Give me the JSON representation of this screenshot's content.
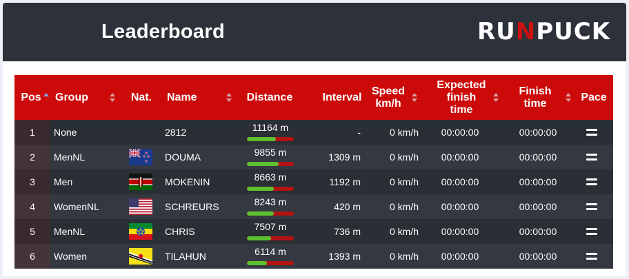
{
  "header": {
    "title": "Leaderboard",
    "logo": {
      "part1": "RU",
      "part2": "N",
      "part3": "PUCK",
      "accent_color": "#cc1111"
    }
  },
  "table": {
    "columns": {
      "pos": "Pos",
      "group": "Group",
      "nat": "Nat.",
      "name": "Name",
      "distance": "Distance",
      "interval": "Interval",
      "speed_line1": "Speed",
      "speed_line2": "km/h",
      "expected_line1": "Expected",
      "expected_line2": "finish",
      "expected_line3": "time",
      "finish_line1": "Finish",
      "finish_line2": "time",
      "pace": "Pace"
    },
    "header_color": "#cc0a0a",
    "rows": [
      {
        "pos": "1",
        "group": "None",
        "flag": "",
        "name": "2812",
        "distance": "11164 m",
        "progress": 0.62,
        "interval": "-",
        "speed": "0 km/h",
        "expected": "00:00:00",
        "finish": "00:00:00"
      },
      {
        "pos": "2",
        "group": "MenNL",
        "flag": "new-zealand-flag",
        "name": "DOUMA",
        "distance": "9855 m",
        "progress": 0.67,
        "interval": "1309 m",
        "speed": "0 km/h",
        "expected": "00:00:00",
        "finish": "00:00:00"
      },
      {
        "pos": "3",
        "group": "Men",
        "flag": "kenya-flag",
        "name": "MOKENIN",
        "distance": "8663 m",
        "progress": 0.58,
        "interval": "1192 m",
        "speed": "0 km/h",
        "expected": "00:00:00",
        "finish": "00:00:00"
      },
      {
        "pos": "4",
        "group": "WomenNL",
        "flag": "usa-flag",
        "name": "SCHREURS",
        "distance": "8243 m",
        "progress": 0.57,
        "interval": "420 m",
        "speed": "0 km/h",
        "expected": "00:00:00",
        "finish": "00:00:00"
      },
      {
        "pos": "5",
        "group": "MenNL",
        "flag": "ethiopia-flag",
        "name": "CHRIS",
        "distance": "7507 m",
        "progress": 0.52,
        "interval": "736 m",
        "speed": "0 km/h",
        "expected": "00:00:00",
        "finish": "00:00:00"
      },
      {
        "pos": "6",
        "group": "Women",
        "flag": "brunei-flag",
        "name": "TILAHUN",
        "distance": "6114 m",
        "progress": 0.43,
        "interval": "1393 m",
        "speed": "0 km/h",
        "expected": "00:00:00",
        "finish": "00:00:00"
      }
    ],
    "progress_color": "#5dc02e",
    "progress_track_color": "#b31313"
  }
}
